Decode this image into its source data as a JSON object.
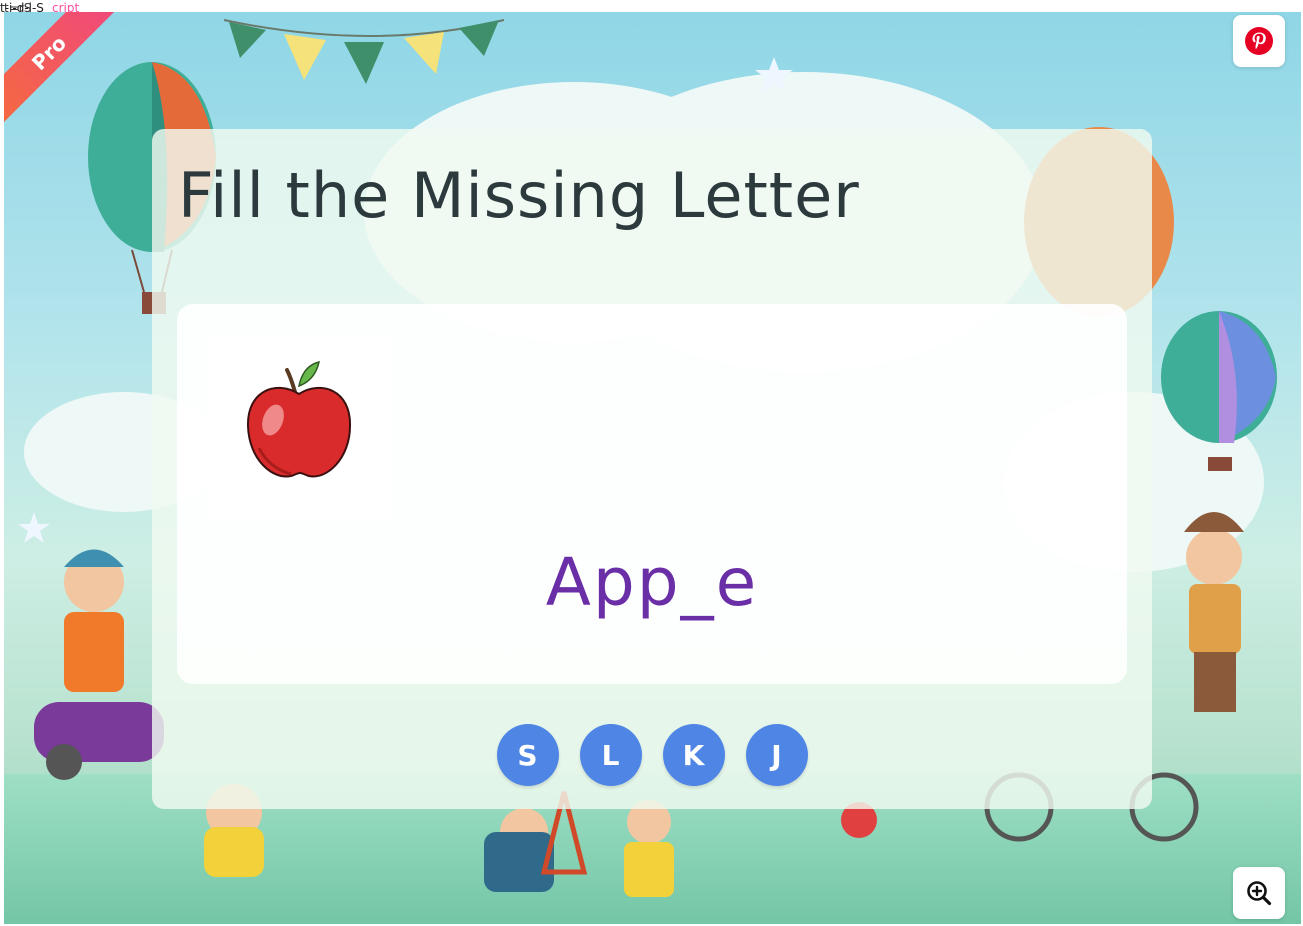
{
  "top_text": {
    "a": "t-i-d-l-S",
    "b": "t=rS",
    "c": "cript"
  },
  "ribbon": {
    "label": "Pro"
  },
  "activity": {
    "title": "Fill the Missing Letter",
    "word": "App_e",
    "choices": [
      "S",
      "L",
      "K",
      "J"
    ]
  },
  "icons": {
    "pinterest": "pinterest-icon",
    "zoom": "zoom-in-icon",
    "apple": "apple-image"
  },
  "colors": {
    "word": "#6a2fa6",
    "choice_bg": "#4f86e6",
    "ribbon": "#f0477e"
  }
}
